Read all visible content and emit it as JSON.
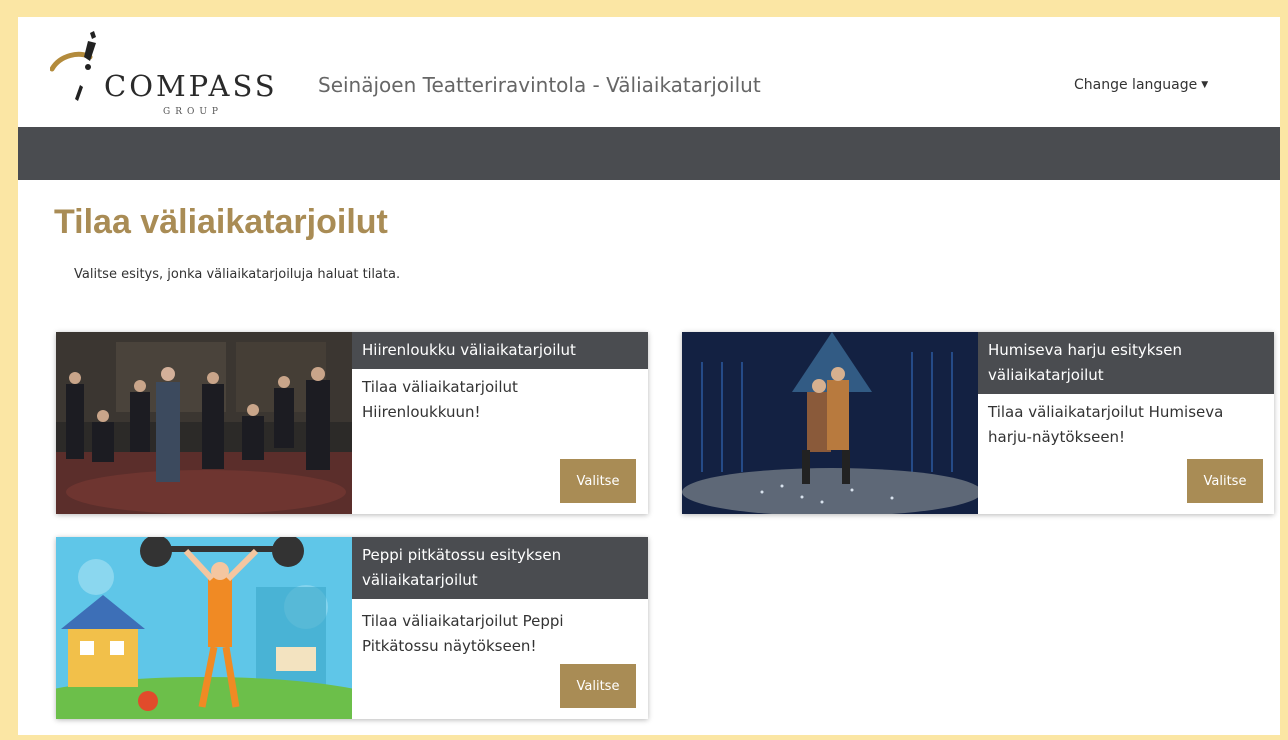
{
  "header": {
    "logo_word": "COMPASS",
    "logo_sub": "GROUP",
    "site_title": "Seinäjoen Teatteriravintola - Väliaikatarjoilut",
    "change_language": "Change language"
  },
  "main": {
    "title": "Tilaa väliaikatarjoilut",
    "intro": "Valitse esitys, jonka väliaikatarjoiluja haluat tilata."
  },
  "cards": [
    {
      "title": "Hiirenloukku väliaikatarjoilut",
      "description": "Tilaa väliaikatarjoilut Hiirenloukkuun!",
      "button": "Valitse"
    },
    {
      "title": "Humiseva harju esityksen väliaikatarjoilut",
      "description": "Tilaa väliaikatarjoilut Humiseva harju-näytökseen!",
      "button": "Valitse"
    },
    {
      "title": "Peppi pitkätossu esityksen väliaikatarjoilut",
      "description": "Tilaa väliaikatarjoilut Peppi Pitkätossu näytökseen!",
      "button": "Valitse"
    }
  ],
  "colors": {
    "accent": "#a98c55",
    "navbar": "#4a4c50",
    "frame": "#fbe6a4"
  },
  "icons": {
    "language_dropdown": "caret-down-icon"
  }
}
